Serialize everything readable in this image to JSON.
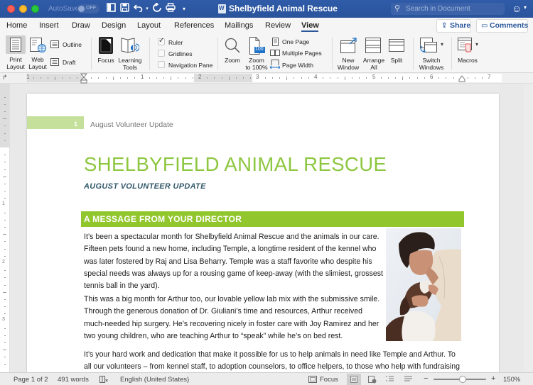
{
  "window": {
    "title": "Shelbyfield Animal Rescue",
    "autosave_label": "AutoSave",
    "autosave_state": "OFF",
    "search_placeholder": "Search in Document",
    "quick_access": [
      "sidebar-icon",
      "save-icon",
      "undo-icon",
      "redo-icon",
      "print-icon",
      "customize-icon"
    ]
  },
  "tabs": [
    {
      "label": "Home",
      "active": false
    },
    {
      "label": "Insert",
      "active": false
    },
    {
      "label": "Draw",
      "active": false
    },
    {
      "label": "Design",
      "active": false
    },
    {
      "label": "Layout",
      "active": false
    },
    {
      "label": "References",
      "active": false
    },
    {
      "label": "Mailings",
      "active": false
    },
    {
      "label": "Review",
      "active": false
    },
    {
      "label": "View",
      "active": true
    }
  ],
  "header_buttons": {
    "share": "Share",
    "comments": "Comments"
  },
  "ribbon": {
    "views": {
      "print_layout": "Print Layout",
      "print_layout_l1": "Print",
      "print_layout_l2": "Layout",
      "web_layout_l1": "Web",
      "web_layout_l2": "Layout",
      "outline": "Outline",
      "draft": "Draft"
    },
    "immersive": {
      "focus": "Focus",
      "learning_l1": "Learning",
      "learning_l2": "Tools"
    },
    "show": [
      {
        "label": "Ruler",
        "checked": true
      },
      {
        "label": "Gridlines",
        "checked": false
      },
      {
        "label": "Navigation Pane",
        "checked": false
      }
    ],
    "zoom": {
      "zoom": "Zoom",
      "zoom100_l1": "Zoom",
      "zoom100_l2": "to 100%",
      "zoom100_badge": "100",
      "one_page": "One Page",
      "multiple_pages": "Multiple Pages",
      "page_width": "Page Width"
    },
    "window": {
      "new_l1": "New",
      "new_l2": "Window",
      "arrange_l1": "Arrange",
      "arrange_l2": "All",
      "split": "Split",
      "switch_l1": "Switch",
      "switch_l2": "Windows"
    },
    "macros": "Macros"
  },
  "ruler": {
    "numbers": [
      "1",
      "1",
      "2",
      "3",
      "4",
      "5",
      "6",
      "7"
    ]
  },
  "document": {
    "header_page_num": "1",
    "header_text": "August Volunteer Update",
    "title": "SHELBYFIELD ANIMAL RESCUE",
    "subtitle": "AUGUST VOLUNTEER UPDATE",
    "section_title": "A MESSAGE FROM YOUR DIRECTOR",
    "paragraph1": [
      "It’s been a spectacular month for Shelbyfield Animal Rescue and the animals in our care.",
      "Fifteen pets found a new home, including Temple, a longtime resident of the kennel who",
      "was later fostered by Raj and Lisa Beharry. Temple was a staff favorite who despite his",
      "special needs was always up for a rousing game of keep-away (with the slimiest, grossest",
      "tennis ball in the yard)."
    ],
    "paragraph2": [
      "This was a big month for Arthur too, our lovable yellow lab mix with the submissive smile.",
      "Through the generous donation of Dr. Giuliani’s time and resources, Arthur received",
      "much-needed hip surgery. He’s recovering nicely in foster care with Joy Ramirez and her",
      "two young children, who are teaching Arthur to “speak” while he’s on bed rest."
    ],
    "paragraph3": [
      "It’s your hard work and dedication that make it possible for us to help animals in need like Temple and Arthur. To",
      "all our volunteers – from kennel staff, to adoption counselors, to office helpers, to those who help with fundraising"
    ],
    "image": "photo of woman smiling at a dog"
  },
  "statusbar": {
    "page": "Page 1 of 2",
    "words": "491 words",
    "language": "English (United States)",
    "focus": "Focus",
    "zoom_minus": "−",
    "zoom_plus": "+",
    "zoom_level": "150%",
    "zoom_slider_fraction": 0.55
  },
  "colors": {
    "titlebar": "#2b579a",
    "accent_green": "#8dc63f",
    "section_green": "#92c62d",
    "header_band": "#c5e09b",
    "subtitle": "#31586a"
  }
}
